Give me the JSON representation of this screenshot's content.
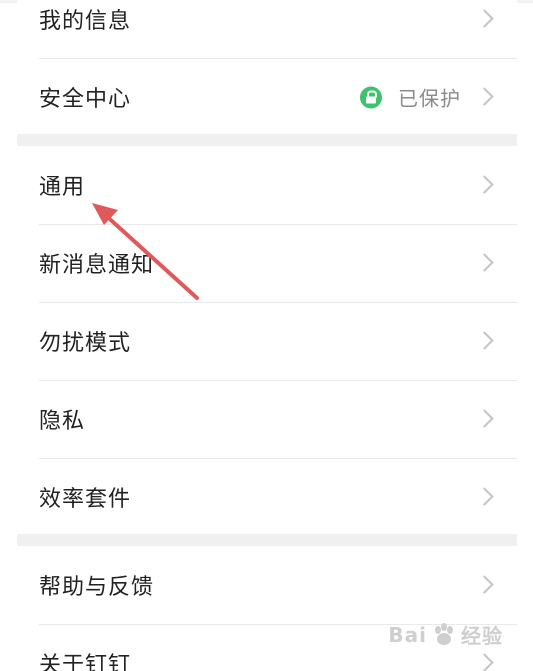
{
  "group1": {
    "items": [
      {
        "label": "我的信息"
      },
      {
        "label": "安全中心",
        "status": "已保护"
      }
    ]
  },
  "group2": {
    "items": [
      {
        "label": "通用"
      },
      {
        "label": "新消息通知"
      },
      {
        "label": "勿扰模式"
      },
      {
        "label": "隐私"
      },
      {
        "label": "效率套件"
      }
    ]
  },
  "group3": {
    "items": [
      {
        "label": "帮助与反馈"
      },
      {
        "label": "关于钉钉"
      }
    ]
  },
  "watermark": {
    "left": "Bai",
    "right": "经验"
  },
  "colors": {
    "lock_green": "#3cc36b",
    "arrow_red": "#e0585a",
    "separator": "#f0f0f0"
  }
}
